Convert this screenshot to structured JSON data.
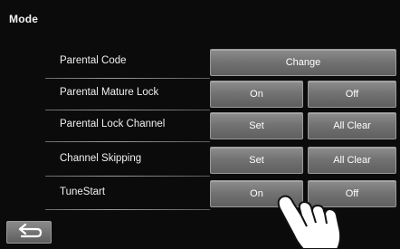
{
  "header": {
    "title": "Mode"
  },
  "rows": [
    {
      "label": "Parental Code",
      "buttons": [
        "Change"
      ]
    },
    {
      "label": "Parental Mature Lock",
      "buttons": [
        "On",
        "Off"
      ]
    },
    {
      "label": "Parental Lock Channel",
      "buttons": [
        "Set",
        "All Clear"
      ]
    },
    {
      "label": "Channel Skipping",
      "buttons": [
        "Set",
        "All Clear"
      ]
    },
    {
      "label": "TuneStart",
      "buttons": [
        "On",
        "Off"
      ]
    }
  ],
  "footer": {
    "back_icon": "return-arrow-icon"
  },
  "overlay": {
    "pointer_icon": "pointing-hand-icon"
  }
}
